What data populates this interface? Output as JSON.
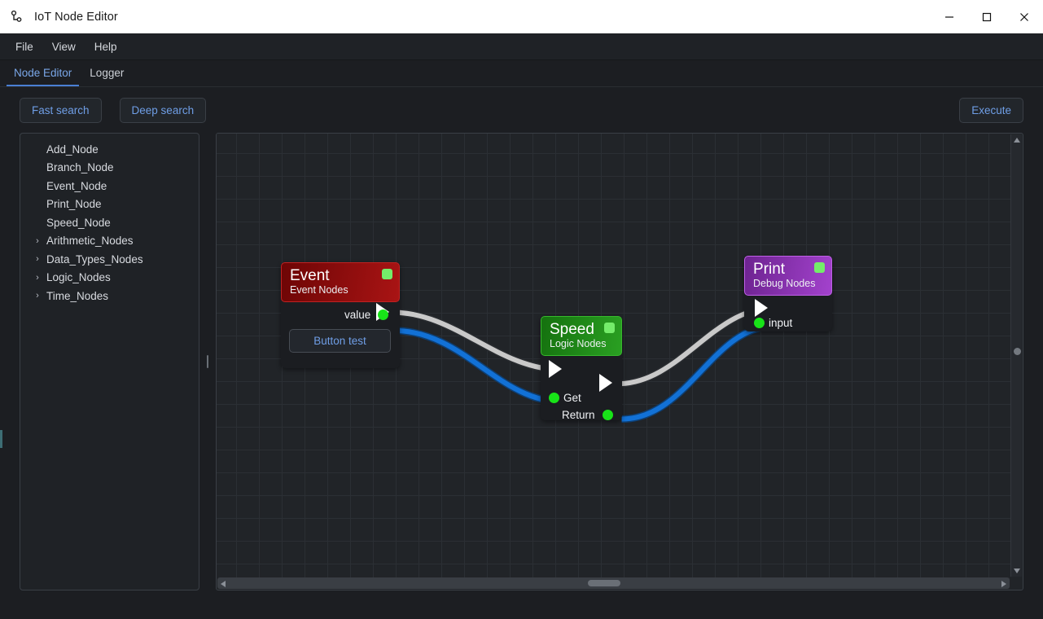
{
  "window": {
    "title": "IoT Node Editor",
    "icon": "node-editor-icon",
    "controls": {
      "minimize": "—",
      "maximize": "□",
      "close": "✕"
    }
  },
  "menubar": {
    "items": [
      "File",
      "View",
      "Help"
    ]
  },
  "tabs": [
    {
      "label": "Node Editor",
      "active": true
    },
    {
      "label": "Logger",
      "active": false
    }
  ],
  "toolbar": {
    "fast_search": "Fast search",
    "deep_search": "Deep search",
    "execute": "Execute"
  },
  "tree": {
    "items": [
      {
        "label": "Add_Node",
        "expandable": false
      },
      {
        "label": "Branch_Node",
        "expandable": false
      },
      {
        "label": "Event_Node",
        "expandable": false
      },
      {
        "label": "Print_Node",
        "expandable": false
      },
      {
        "label": "Speed_Node",
        "expandable": false
      },
      {
        "label": "Arithmetic_Nodes",
        "expandable": true
      },
      {
        "label": "Data_Types_Nodes",
        "expandable": true
      },
      {
        "label": "Logic_Nodes",
        "expandable": true
      },
      {
        "label": "Time_Nodes",
        "expandable": true
      }
    ],
    "chevron": "›"
  },
  "canvas": {
    "nodes": [
      {
        "id": "event",
        "title": "Event",
        "subtitle": "Event Nodes",
        "header_color": "#a91414",
        "badge_color": "#74ec6a",
        "outputs": [
          {
            "name": "value",
            "type": "data"
          }
        ],
        "button": "Button test"
      },
      {
        "id": "speed",
        "title": "Speed",
        "subtitle": "Logic Nodes",
        "header_color": "#2aa022",
        "badge_color": "#74ec6a",
        "inputs": [
          {
            "name": "Get",
            "type": "data"
          }
        ],
        "outputs": [
          {
            "name": "Return",
            "type": "data"
          }
        ]
      },
      {
        "id": "print",
        "title": "Print",
        "subtitle": "Debug Nodes",
        "header_color": "#a342cd",
        "badge_color": "#74ec6a",
        "inputs": [
          {
            "name": "input",
            "type": "data"
          }
        ]
      }
    ],
    "wire_colors": {
      "exec": "#c9c9c9",
      "data": "#1271d6"
    }
  }
}
